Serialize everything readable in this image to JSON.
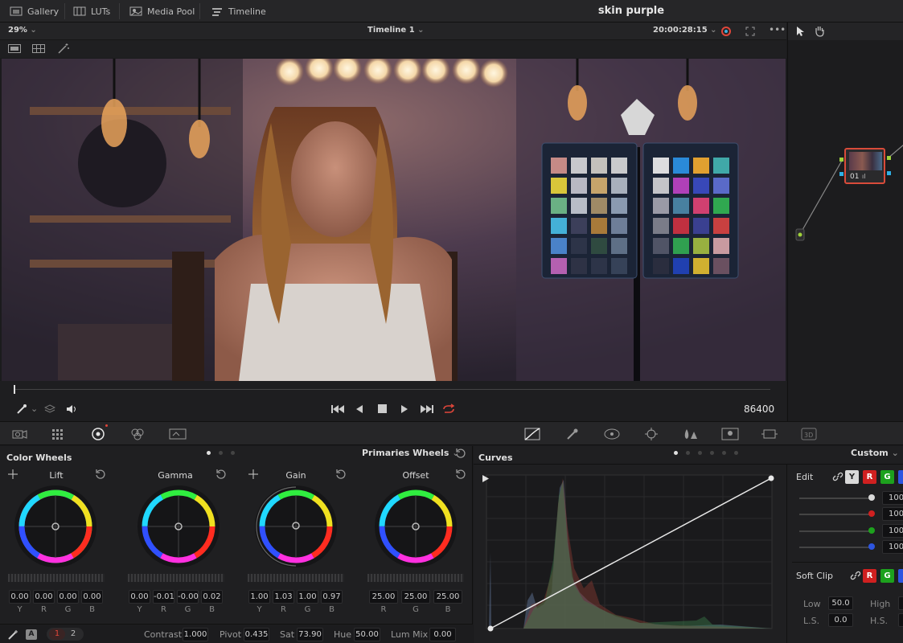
{
  "topbar": {
    "gallery": "Gallery",
    "luts": "LUTs",
    "media_pool": "Media Pool",
    "timeline": "Timeline",
    "project_title": "skin purple"
  },
  "viewer_bar": {
    "zoom": "29%",
    "timeline_name": "Timeline 1",
    "timecode": "20:00:28:15"
  },
  "node": {
    "label": "01"
  },
  "transport": {
    "frame": "86400"
  },
  "color_wheels": {
    "title": "Color Wheels",
    "mode": "Primaries Wheels",
    "wheels": [
      {
        "name": "Lift",
        "values": [
          "0.00",
          "0.00",
          "0.00",
          "0.00"
        ]
      },
      {
        "name": "Gamma",
        "values": [
          "0.00",
          "-0.01",
          "-0.00",
          "0.02"
        ]
      },
      {
        "name": "Gain",
        "values": [
          "1.00",
          "1.03",
          "1.00",
          "0.97"
        ]
      },
      {
        "name": "Offset",
        "values": [
          "25.00",
          "25.00",
          "25.00"
        ]
      }
    ],
    "channel_labels_ybgr": [
      "Y",
      "R",
      "G",
      "B"
    ],
    "channel_labels_rgb": [
      "R",
      "G",
      "B"
    ]
  },
  "bottom_params": {
    "page1": "1",
    "page2": "2",
    "contrast_label": "Contrast",
    "contrast": "1.000",
    "pivot_label": "Pivot",
    "pivot": "0.435",
    "sat_label": "Sat",
    "sat": "73.90",
    "hue_label": "Hue",
    "hue": "50.00",
    "lummix_label": "Lum Mix",
    "lummix": "0.00"
  },
  "curves": {
    "title": "Curves",
    "mode": "Custom",
    "edit_label": "Edit",
    "channels": [
      "Y",
      "R",
      "G",
      "B"
    ],
    "intensities": [
      "100",
      "100",
      "100",
      "100"
    ],
    "soft_clip_label": "Soft Clip",
    "low_label": "Low",
    "low": "50.0",
    "high_label": "High",
    "ls_label": "L.S.",
    "ls": "0.0",
    "hs_label": "H.S."
  },
  "colors": {
    "accent_red": "#e0463a",
    "y_channel": "#d9d9d9",
    "r_channel": "#d02020",
    "g_channel": "#1da11d",
    "b_channel": "#2d55e0",
    "node_border": "#d94b3a"
  }
}
